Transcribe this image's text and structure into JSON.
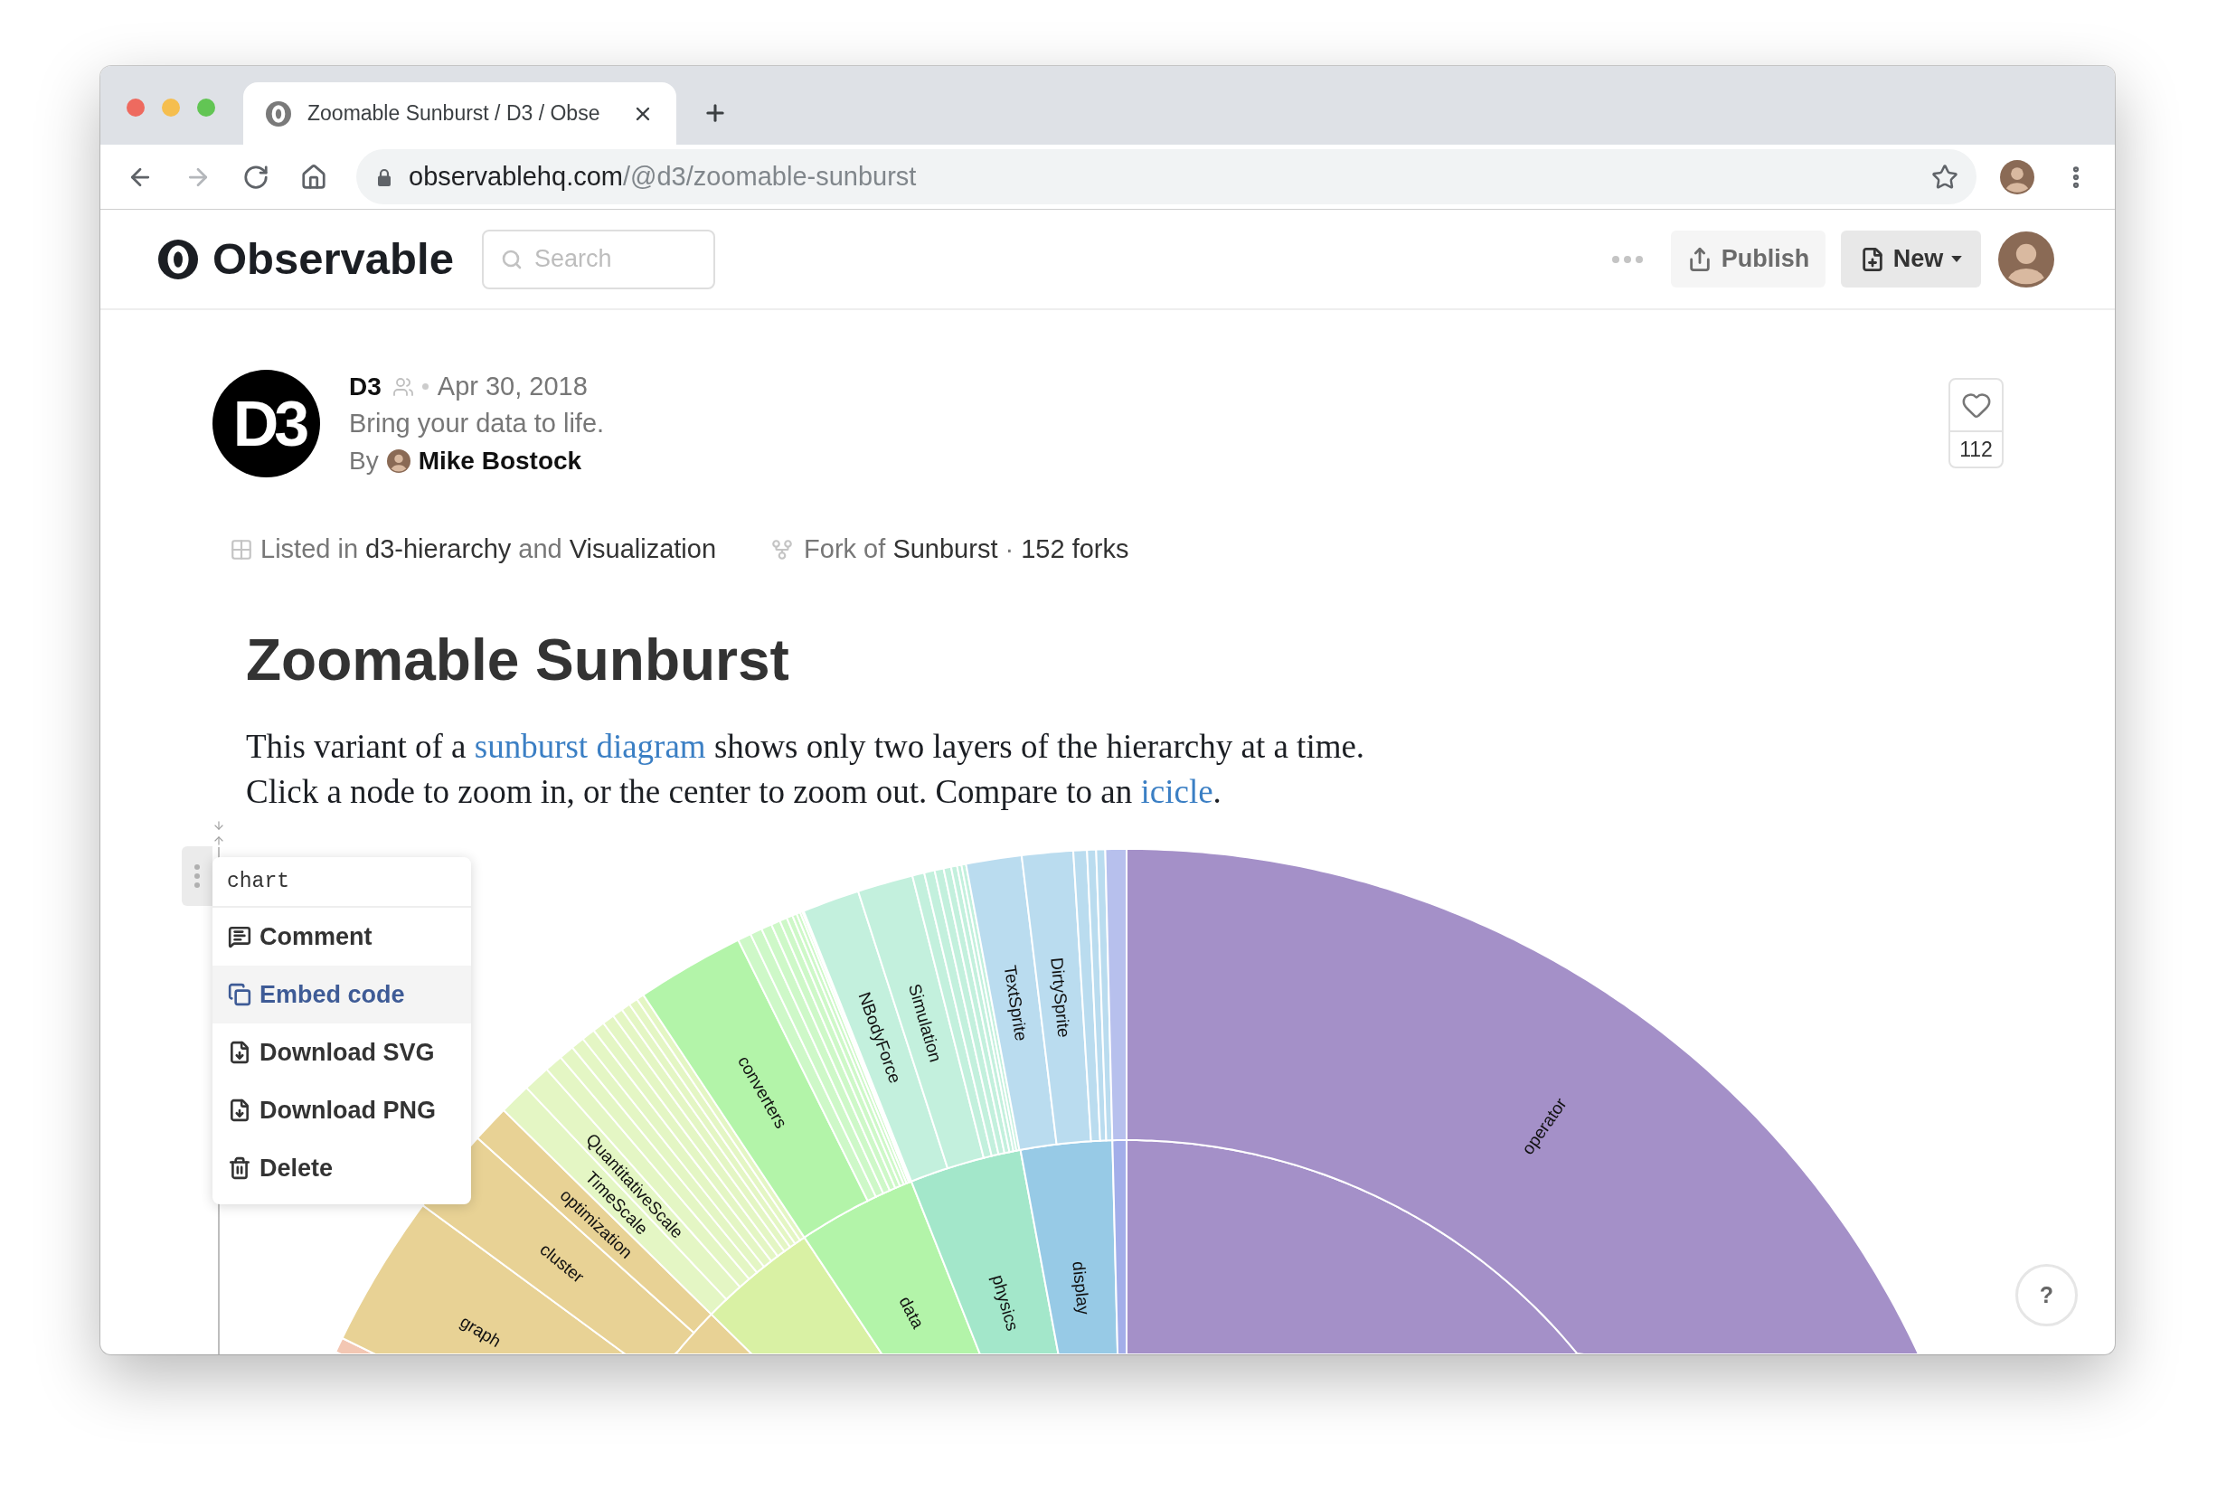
{
  "browser": {
    "tab": {
      "title": "Zoomable Sunburst / D3 / Obse",
      "selected": true
    },
    "address": {
      "host": "observablehq.com",
      "path": "/@d3/zoomable-sunburst"
    }
  },
  "header": {
    "brand": "Observable",
    "search": {
      "placeholder": "Search"
    },
    "buttons": [
      {
        "kind": "publish",
        "label": "Publish"
      },
      {
        "kind": "new",
        "label": "New"
      }
    ]
  },
  "notebook": {
    "owner": {
      "logo_text": "D3",
      "name": "D3",
      "date": "Apr 30, 2018",
      "tagline": "Bring your data to life.",
      "by": "By",
      "author": "Mike Bostock"
    },
    "likes": {
      "count": "112",
      "liked": false
    },
    "listed_in": [
      {
        "text": "Listed in ",
        "link": false
      },
      {
        "text": "d3-hierarchy",
        "link": true
      },
      {
        "text": " and ",
        "link": false
      },
      {
        "text": "Visualization",
        "link": true
      }
    ],
    "fork": [
      {
        "text": "Fork of ",
        "link": false
      },
      {
        "text": "Sunburst",
        "link": true
      },
      {
        "text": " · ",
        "link": false
      },
      {
        "text": "152 forks",
        "link": true
      }
    ],
    "title": "Zoomable Sunburst",
    "description": [
      [
        {
          "text": "This variant of a ",
          "link": false
        },
        {
          "text": "sunburst diagram",
          "link": true
        },
        {
          "text": " shows only two layers of the hierarchy at a time.",
          "link": false
        }
      ],
      [
        {
          "text": "Click a node to zoom in, or the center to zoom out. Compare to an ",
          "link": false
        },
        {
          "text": "icicle",
          "link": true
        },
        {
          "text": ".",
          "link": false
        }
      ]
    ]
  },
  "cell": {
    "name": "chart",
    "menu": [
      {
        "label": "Comment",
        "selected": false
      },
      {
        "label": "Embed code",
        "selected": true
      },
      {
        "label": "Download SVG",
        "selected": false
      },
      {
        "label": "Download PNG",
        "selected": false
      },
      {
        "label": "Delete",
        "selected": false
      }
    ]
  },
  "sunburst": {
    "inner_labels": [
      "data",
      "physics",
      "display"
    ],
    "outer_labels": [
      "graph",
      "cluster",
      "optimization",
      "TimeScale",
      "QuantitativeScale",
      "converters",
      "NBodyForce",
      "Simulation",
      "TextSprite",
      "DirtySprite",
      "operator"
    ]
  },
  "help": {
    "label": "?"
  }
}
